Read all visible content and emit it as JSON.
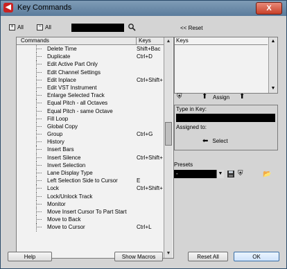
{
  "window": {
    "title": "Key Commands",
    "icon": "app-icon",
    "close_label": "X"
  },
  "toolbar": {
    "expand_all": "All",
    "collapse_all": "All",
    "reset_label": "<< Reset"
  },
  "table": {
    "headers": {
      "commands": "Commands",
      "keys": "Keys"
    },
    "rows": [
      {
        "cmd": "Delete Time",
        "key": "Shift+Bac"
      },
      {
        "cmd": "Duplicate",
        "key": "Ctrl+D"
      },
      {
        "cmd": "Edit Active Part Only",
        "key": ""
      },
      {
        "cmd": "Edit Channel Settings",
        "key": ""
      },
      {
        "cmd": "Edit Inplace",
        "key": "Ctrl+Shift+"
      },
      {
        "cmd": "Edit VST Instrument",
        "key": ""
      },
      {
        "cmd": "Enlarge Selected Track",
        "key": ""
      },
      {
        "cmd": "Equal Pitch - all Octaves",
        "key": ""
      },
      {
        "cmd": "Equal Pitch - same Octave",
        "key": ""
      },
      {
        "cmd": "Fill Loop",
        "key": ""
      },
      {
        "cmd": "Global Copy",
        "key": ""
      },
      {
        "cmd": "Group",
        "key": "Ctrl+G"
      },
      {
        "cmd": "History",
        "key": ""
      },
      {
        "cmd": "Insert Bars",
        "key": ""
      },
      {
        "cmd": "Insert Silence",
        "key": "Ctrl+Shift+"
      },
      {
        "cmd": "Invert Selection",
        "key": ""
      },
      {
        "cmd": "Lane Display Type",
        "key": ""
      },
      {
        "cmd": "Left Selection Side to Cursor",
        "key": "E"
      },
      {
        "cmd": "Lock",
        "key": "Ctrl+Shift+"
      },
      {
        "cmd": "Lock/Unlock Track",
        "key": ""
      },
      {
        "cmd": "Monitor",
        "key": ""
      },
      {
        "cmd": "Move Insert Cursor To Part Start",
        "key": ""
      },
      {
        "cmd": "Move to Back",
        "key": ""
      },
      {
        "cmd": "Move to Cursor",
        "key": "Ctrl+L"
      }
    ]
  },
  "keys_panel": {
    "header": "Keys"
  },
  "assign": {
    "label": "Assign"
  },
  "type_in_key": {
    "label": "Type in Key:",
    "assigned_label": "Assigned to:",
    "select_label": "Select"
  },
  "presets": {
    "label": "Presets",
    "value": "-"
  },
  "buttons": {
    "help": "Help",
    "show_macros": "Show Macros",
    "reset_all": "Reset All",
    "ok": "OK"
  }
}
